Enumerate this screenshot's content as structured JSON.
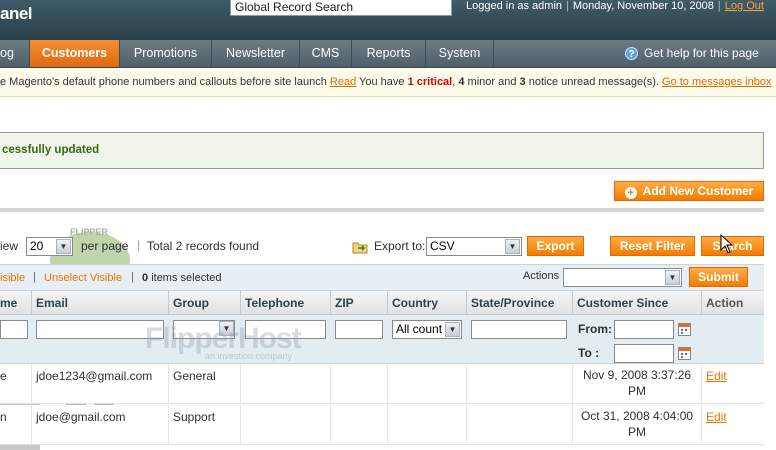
{
  "header": {
    "panel_title": "anel",
    "global_search_value": "Global Record Search",
    "logged_in": "Logged in as admin",
    "date": "Monday, November 10, 2008",
    "logout": "Log Out"
  },
  "nav": {
    "items": [
      "og",
      "Customers",
      "Promotions",
      "Newsletter",
      "CMS",
      "Reports",
      "System"
    ],
    "active": "Customers",
    "help": "Get help for this page"
  },
  "notice": {
    "text1": "e Magento's default phone numbers and callouts before site launch",
    "read": "Read",
    "text2": "You have",
    "critical": "1 critical",
    "minor_count": "4",
    "minor_text": "minor and",
    "notice_count": "3",
    "notice_text": "notice unread message(s).",
    "goto": "Go to messages inbox"
  },
  "success_message": "cessfully updated",
  "buttons": {
    "add_new_customer": "Add New Customer",
    "export": "Export",
    "reset_filter": "Reset Filter",
    "search": "Search",
    "submit": "Submit"
  },
  "pager": {
    "view": "iew",
    "per_page_value": "20",
    "per_page": "per page",
    "total": "Total 2 records found",
    "export_to": "Export to:",
    "export_format": "CSV"
  },
  "massaction": {
    "select_visible": "isible",
    "unselect_visible": "Unselect Visible",
    "selected_count": "0",
    "selected_text": "items selected",
    "actions_label": "Actions"
  },
  "grid": {
    "columns": [
      "me",
      "Email",
      "Group",
      "Telephone",
      "ZIP",
      "Country",
      "State/Province",
      "Customer Since",
      "Action"
    ],
    "country_filter": "All count",
    "from": "From:",
    "to": "To :",
    "rows": [
      {
        "name": "e",
        "email": "jdoe1234@gmail.com",
        "group": "General",
        "since": "Nov 9, 2008 3:37:26 PM",
        "action": "Edit"
      },
      {
        "name": "n",
        "email": "jdoe@gmail.com",
        "group": "Support",
        "since": "Oct 31, 2008 4:04:00 PM",
        "action": "Edit"
      }
    ]
  },
  "watermark": {
    "brand": "FlipperHost",
    "tagline": "an investion company",
    "badge": "FLIPPER"
  },
  "colors": {
    "header_bg": "#2f4651",
    "nav_active": "#ea7108",
    "button": "#f58a1f",
    "success_text": "#3d6611",
    "link": "#ea7601"
  }
}
